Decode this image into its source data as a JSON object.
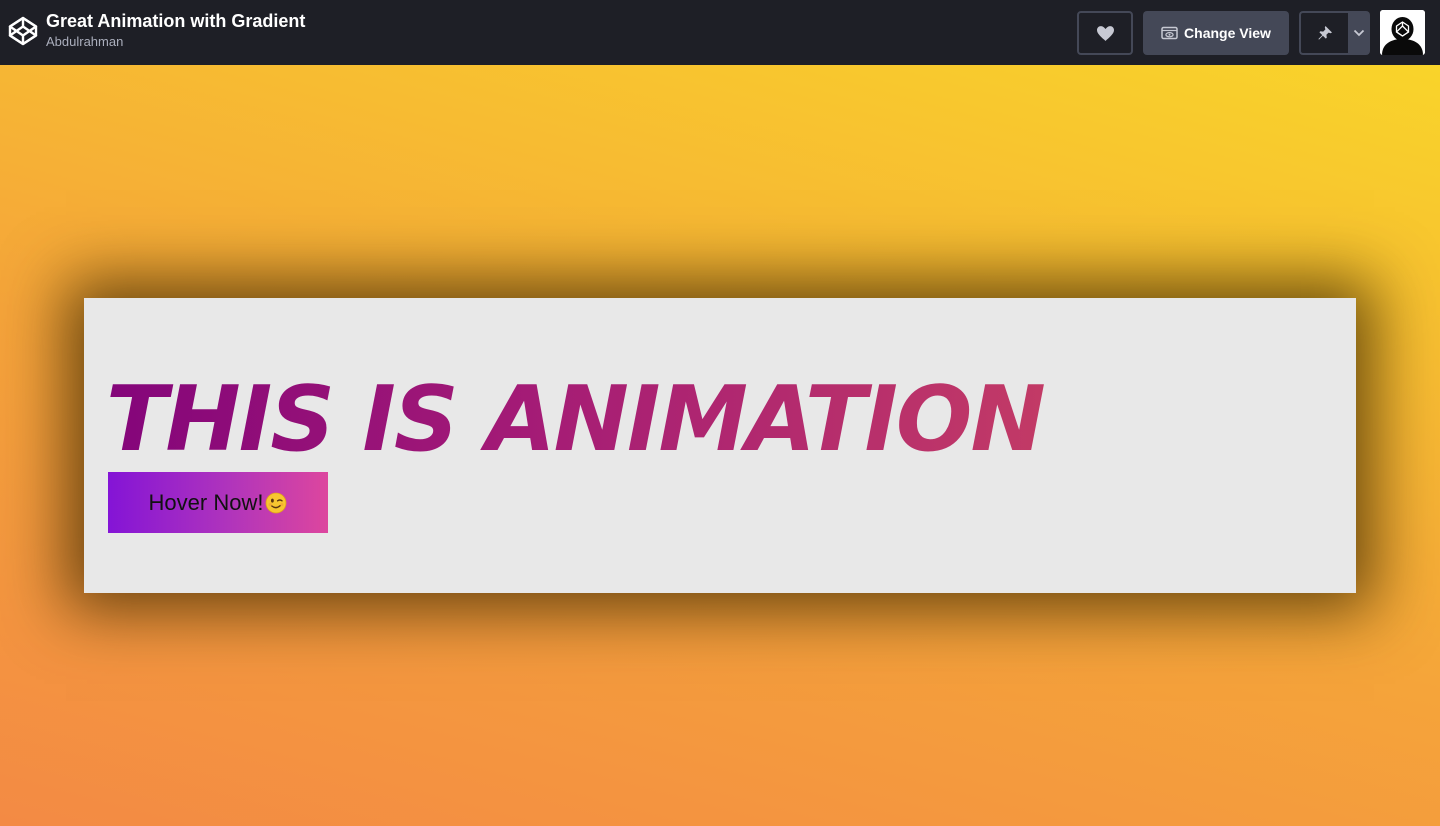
{
  "header": {
    "pen_title": "Great Animation with Gradient",
    "author": "Abdulrahman",
    "logo_icon": "codepen-logo-icon",
    "like_icon": "heart-icon",
    "change_view_label": "Change View",
    "change_view_icon": "eye-window-icon",
    "pin_icon": "pin-icon",
    "dropdown_icon": "chevron-down-icon",
    "avatar_icon": "user-avatar-icon"
  },
  "content": {
    "headline": "THIS IS ANIMATION",
    "button_label": "Hover Now!",
    "button_emoji": "winking-face-emoji"
  },
  "colors": {
    "topbar": "#1e1f26",
    "button_dark": "#444857",
    "bg_gradient_start": "#f38a44",
    "bg_gradient_end": "#f9d42a",
    "card_bg": "#e8e8e8",
    "headline_gradient_start": "#84057a",
    "headline_gradient_end": "#c23a66",
    "button_gradient_start": "#8414d6",
    "button_gradient_end": "#dd469e"
  }
}
